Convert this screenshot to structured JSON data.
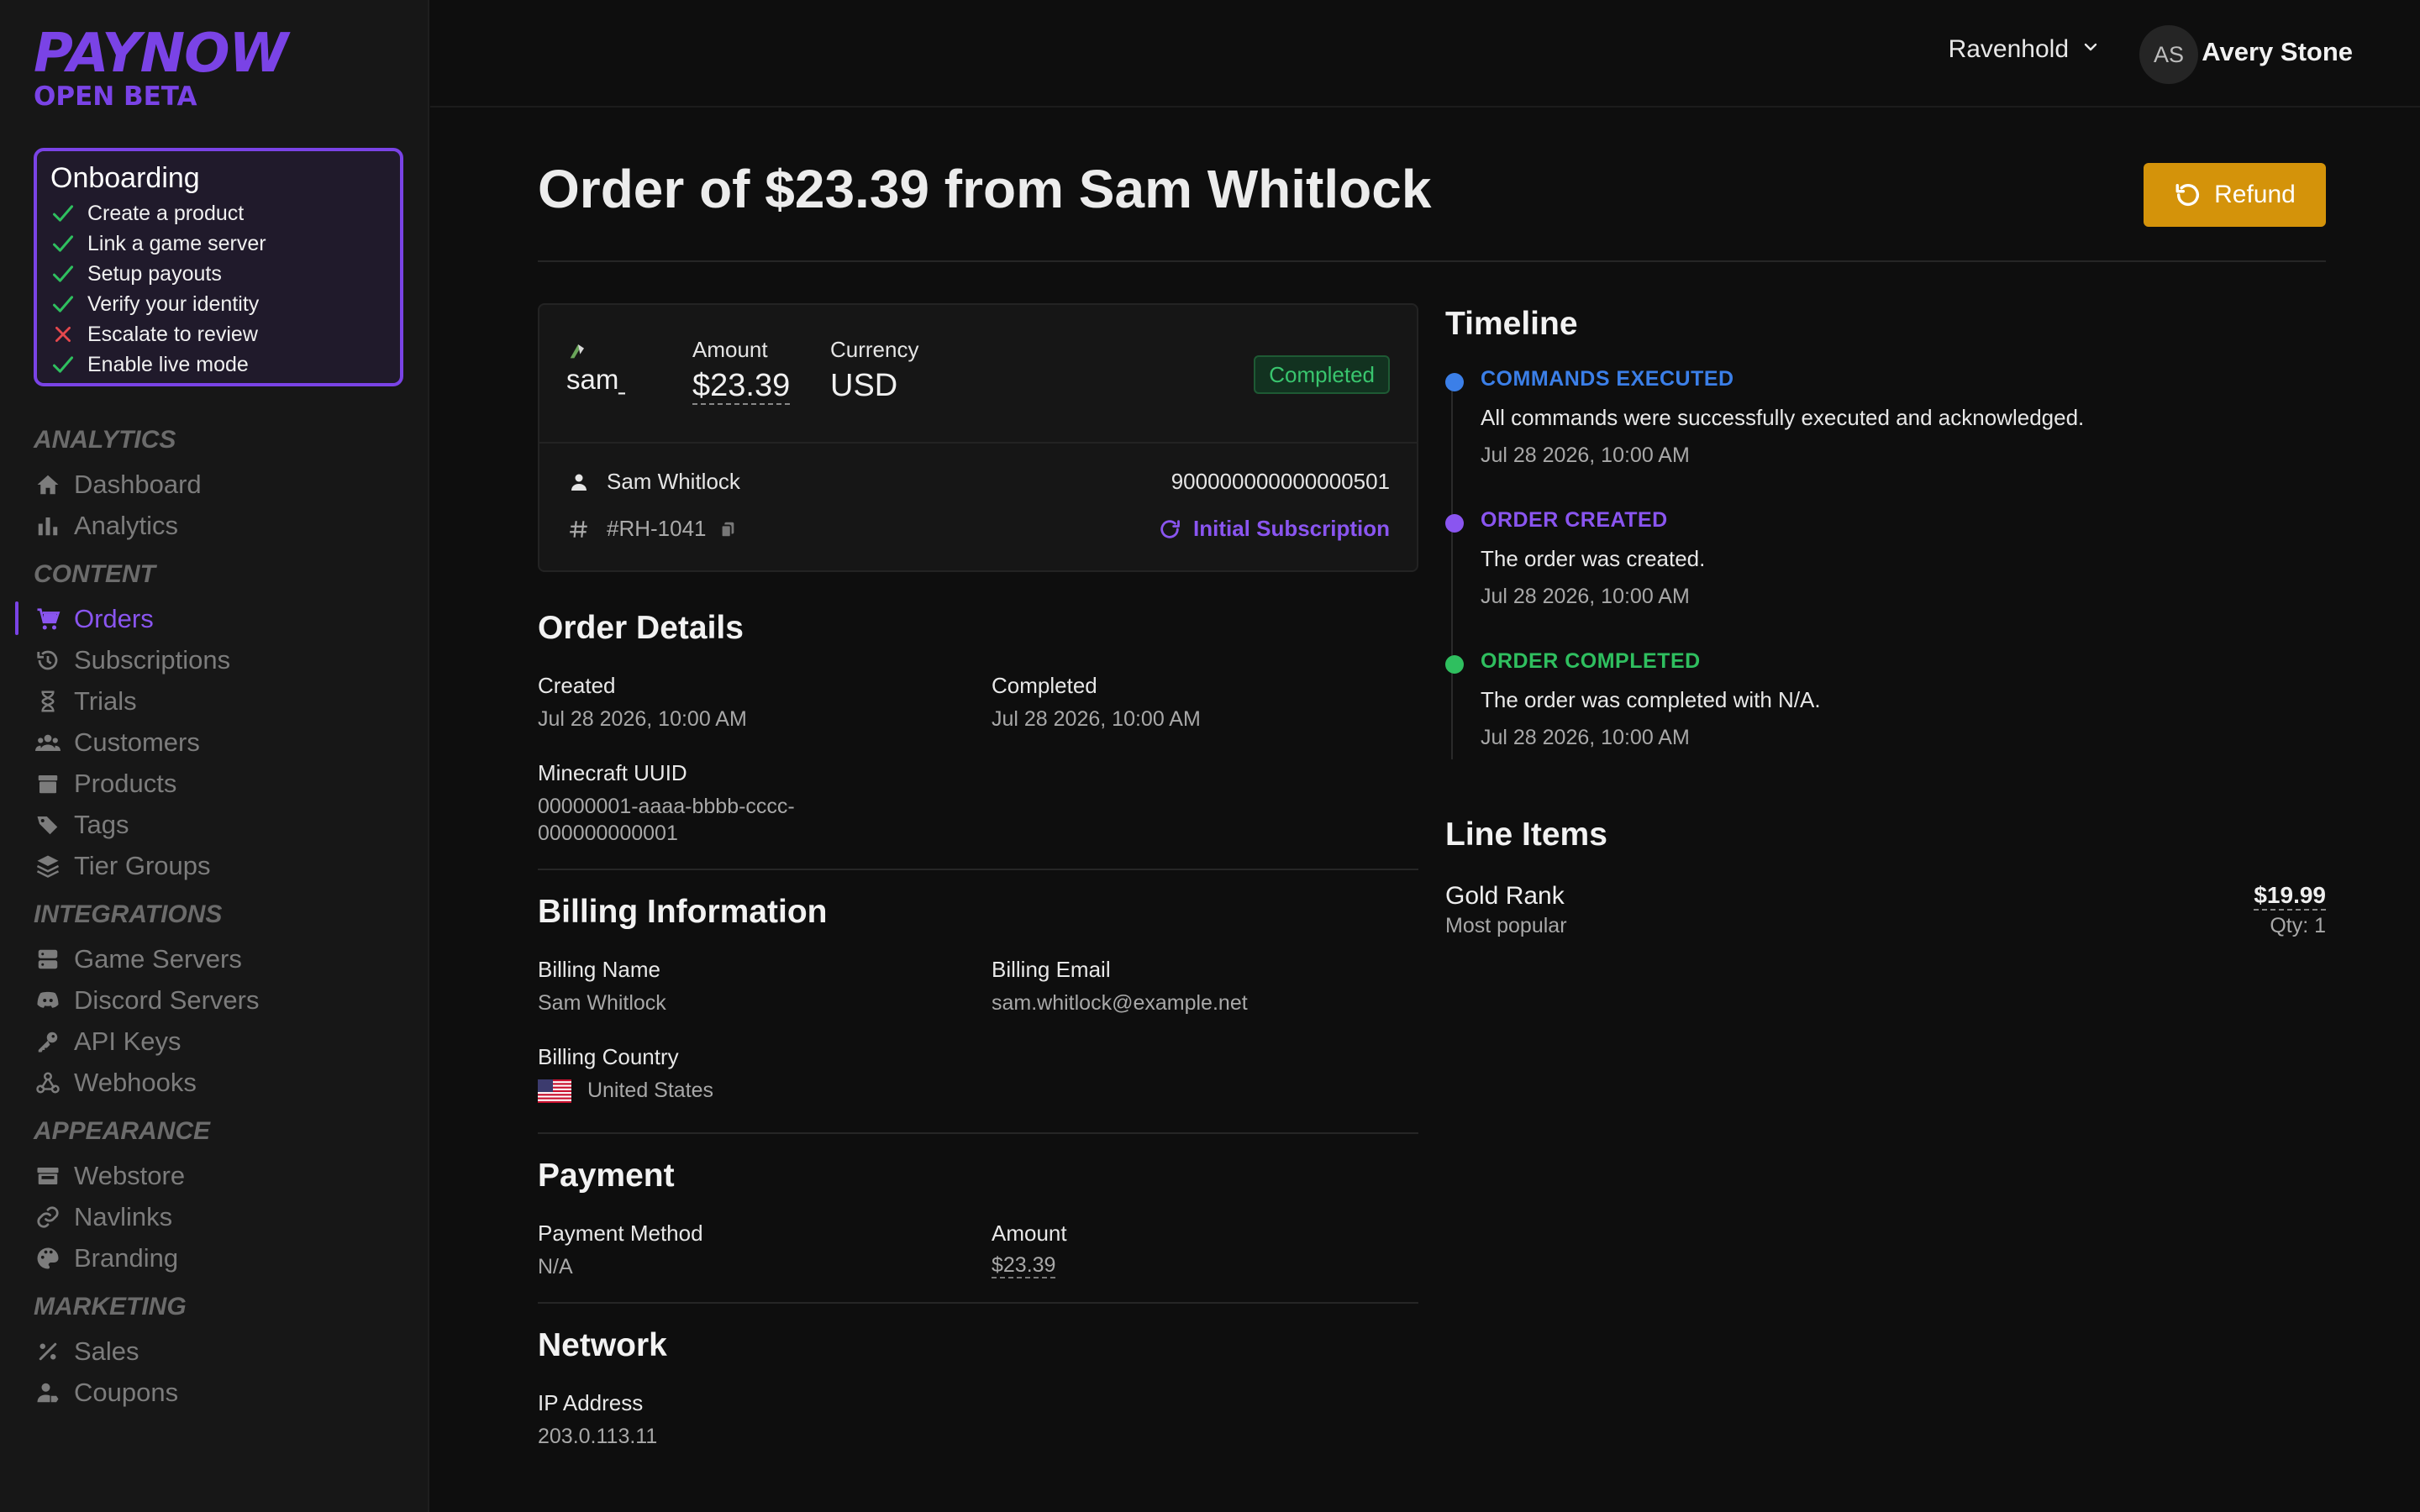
{
  "brand": {
    "name": "PAYNOW",
    "tagline": "OPEN BETA",
    "color": "#7a43e6"
  },
  "onboarding": {
    "title": "Onboarding",
    "items": [
      {
        "label": "Create a product",
        "done": true
      },
      {
        "label": "Link a game server",
        "done": true
      },
      {
        "label": "Setup payouts",
        "done": true
      },
      {
        "label": "Verify your identity",
        "done": true
      },
      {
        "label": "Escalate to review",
        "done": false
      },
      {
        "label": "Enable live mode",
        "done": true
      }
    ]
  },
  "sidebar": {
    "analytics": {
      "title": "ANALYTICS",
      "items": [
        {
          "label": "Dashboard",
          "icon": "home-icon"
        },
        {
          "label": "Analytics",
          "icon": "bar-chart-icon"
        }
      ]
    },
    "content": {
      "title": "CONTENT",
      "items": [
        {
          "label": "Orders",
          "icon": "cart-icon",
          "active": true
        },
        {
          "label": "Subscriptions",
          "icon": "history-icon"
        },
        {
          "label": "Trials",
          "icon": "hourglass-icon"
        },
        {
          "label": "Customers",
          "icon": "users-icon"
        },
        {
          "label": "Products",
          "icon": "archive-icon"
        },
        {
          "label": "Tags",
          "icon": "tags-icon"
        },
        {
          "label": "Tier Groups",
          "icon": "layers-icon"
        }
      ]
    },
    "integrations": {
      "title": "INTEGRATIONS",
      "items": [
        {
          "label": "Game Servers",
          "icon": "server-icon"
        },
        {
          "label": "Discord Servers",
          "icon": "discord-icon"
        },
        {
          "label": "API Keys",
          "icon": "key-icon"
        },
        {
          "label": "Webhooks",
          "icon": "webhook-icon"
        }
      ]
    },
    "appearance": {
      "title": "APPEARANCE",
      "items": [
        {
          "label": "Webstore",
          "icon": "store-icon"
        },
        {
          "label": "Navlinks",
          "icon": "link-icon"
        },
        {
          "label": "Branding",
          "icon": "palette-icon"
        }
      ]
    },
    "marketing": {
      "title": "MARKETING",
      "items": [
        {
          "label": "Sales",
          "icon": "percent-icon"
        },
        {
          "label": "Coupons",
          "icon": "user-tag-icon"
        }
      ]
    }
  },
  "header": {
    "workspace": "Ravenhold",
    "avatar_initials": "AS",
    "user_name": "Avery Stone"
  },
  "page": {
    "title": "Order of $23.39 from Sam Whitlock",
    "refund_label": "Refund"
  },
  "order_card": {
    "player_alt": "sam_v",
    "amount_label": "Amount",
    "amount": "$23.39",
    "currency_label": "Currency",
    "currency": "USD",
    "status": "Completed",
    "customer_name": "Sam Whitlock",
    "order_ref": "#RH-1041",
    "order_id": "900000000000000501",
    "subscription_link": "Initial Subscription"
  },
  "order_details": {
    "title": "Order Details",
    "created_label": "Created",
    "created": "Jul 28 2026, 10:00 AM",
    "completed_label": "Completed",
    "completed": "Jul 28 2026, 10:00 AM",
    "uuid_label": "Minecraft UUID",
    "uuid_line1": "00000001-aaaa-bbbb-cccc-",
    "uuid_line2": "000000000001"
  },
  "billing": {
    "title": "Billing Information",
    "name_label": "Billing Name",
    "name": "Sam Whitlock",
    "email_label": "Billing Email",
    "email": "sam.whitlock@example.net",
    "country_label": "Billing Country",
    "country": "United States"
  },
  "payment": {
    "title": "Payment",
    "method_label": "Payment Method",
    "method": "N/A",
    "amount_label": "Amount",
    "amount": "$23.39"
  },
  "network": {
    "title": "Network",
    "ip_label": "IP Address",
    "ip": "203.0.113.11"
  },
  "timeline": {
    "title": "Timeline",
    "events": [
      {
        "title": "COMMANDS EXECUTED",
        "description": "All commands were successfully executed and acknowledged.",
        "time": "Jul 28 2026, 10:00 AM",
        "color": "#3b7fe8"
      },
      {
        "title": "ORDER CREATED",
        "description": "The order was created.",
        "time": "Jul 28 2026, 10:00 AM",
        "color": "#8a55f0"
      },
      {
        "title": "ORDER COMPLETED",
        "description": "The order was completed with N/A.",
        "time": "Jul 28 2026, 10:00 AM",
        "color": "#2fbf5f"
      }
    ]
  },
  "line_items": {
    "title": "Line Items",
    "items": [
      {
        "name": "Gold Rank",
        "subtitle": "Most popular",
        "price": "$19.99",
        "qty": "Qty: 1"
      }
    ]
  },
  "colors": {
    "accent": "#7a43e6",
    "refund": "#d4930a",
    "success": "#39c56e",
    "error": "#e5484d"
  }
}
